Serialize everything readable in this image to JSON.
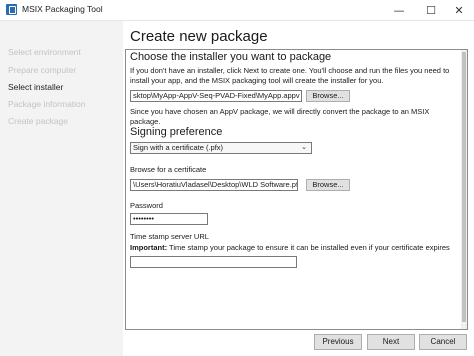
{
  "window": {
    "title": "MSIX Packaging Tool",
    "minimize_glyph": "—",
    "maximize_glyph": "☐",
    "close_glyph": "✕"
  },
  "sidebar": {
    "items": [
      {
        "label": "Select environment",
        "state": "disabled"
      },
      {
        "label": "Prepare computer",
        "state": "disabled"
      },
      {
        "label": "Select installer",
        "state": "active"
      },
      {
        "label": "Package information",
        "state": "disabled"
      },
      {
        "label": "Create package",
        "state": "disabled"
      }
    ]
  },
  "page": {
    "title": "Create new package"
  },
  "installer": {
    "heading": "Choose the installer you want to package",
    "description": "If you don't have an installer, click Next to create one. You'll choose and run the files you need to install your app, and the MSIX packaging tool will create the installer for you.",
    "path_value": "sktop\\MyApp-AppV-Seq-PVAD-Fixed\\MyApp.appv",
    "browse_label": "Browse...",
    "appv_note": "Since you have chosen an AppV package, we will directly convert the package to an MSIX package."
  },
  "signing": {
    "heading": "Signing preference",
    "selected_option": "Sign with a certificate (.pfx)",
    "chevron_glyph": "⌄",
    "certificate_label": "Browse for a certificate",
    "certificate_value": "\\Users\\HoratiuVladasel\\Desktop\\WLD Software.pfx",
    "browse_label": "Browse...",
    "password_label": "Password",
    "password_value": "••••••••",
    "timestamp_label": "Time stamp server URL",
    "important_label": "Important:",
    "important_text": "Time stamp your package to ensure it can be installed even if your certificate expires",
    "timestamp_value": ""
  },
  "footer": {
    "previous_label": "Previous",
    "next_label": "Next",
    "cancel_label": "Cancel"
  },
  "colors": {
    "sidebar_bg": "#f3f3f3",
    "disabled_text": "#c3c3c3",
    "button_bg": "#e1e1e1",
    "app_icon": "#2b6cb0"
  }
}
